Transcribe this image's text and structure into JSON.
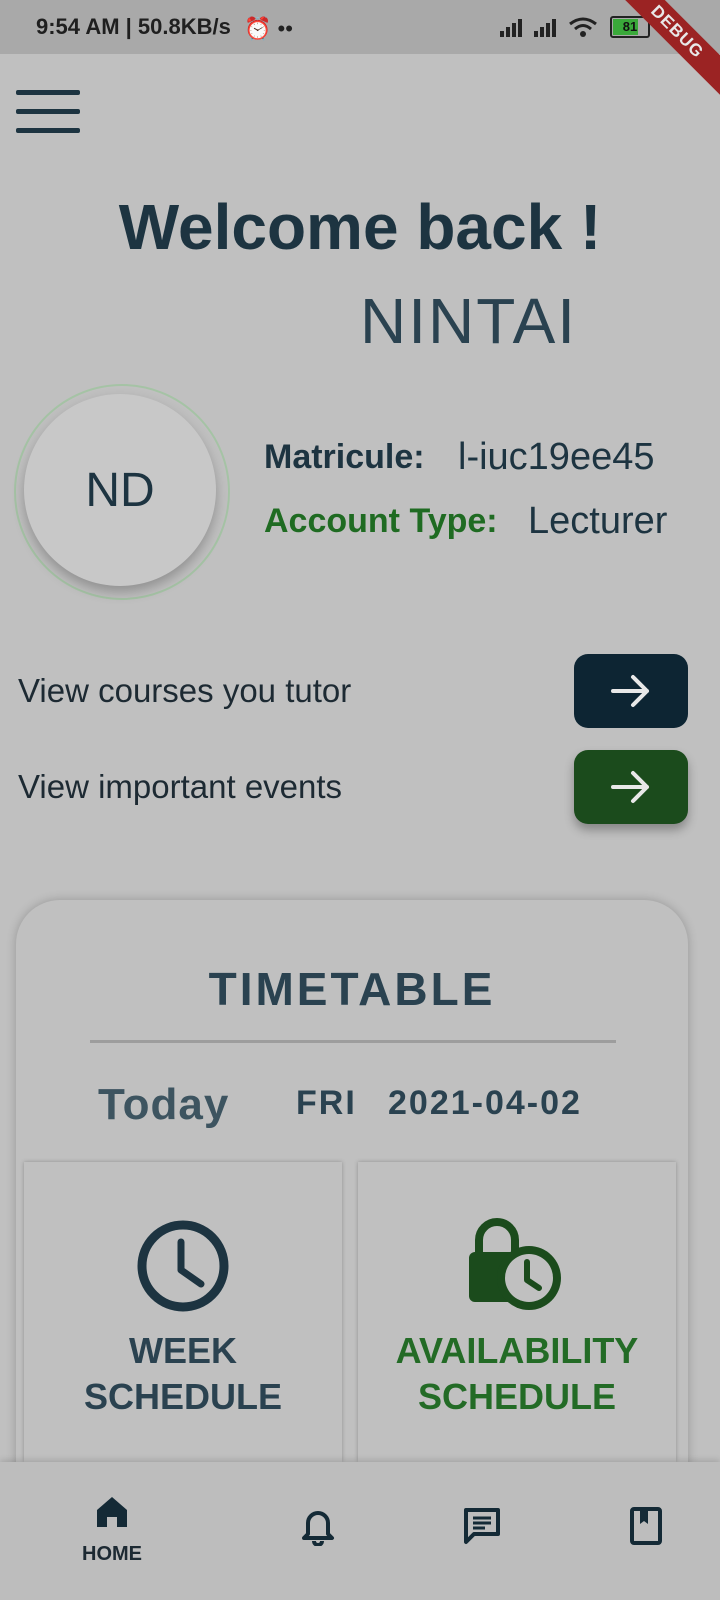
{
  "status_bar": {
    "time_speed": "9:54 AM | 50.8KB/s",
    "battery": "81",
    "debug_banner": "DEBUG"
  },
  "header": {
    "greeting": "Welcome back !",
    "username": "NINTAI"
  },
  "profile": {
    "initials": "ND",
    "matricule_label": "Matricule:",
    "matricule_value": "l-iuc19ee45",
    "account_type_label": "Account Type:",
    "account_type_value": "Lecturer"
  },
  "links": [
    {
      "label": "View courses you tutor",
      "color": "#0d2533"
    },
    {
      "label": "View important events",
      "color": "#1b4b1c"
    }
  ],
  "timetable": {
    "title": "TIMETABLE",
    "today_label": "Today",
    "day": "FRI",
    "date": "2021-04-02",
    "tiles": [
      {
        "label_line1": "WEEK",
        "label_line2": "SCHEDULE",
        "icon": "clock-icon"
      },
      {
        "label_line1": "AVAILABILITY",
        "label_line2": "SCHEDULE",
        "icon": "lock-clock-icon"
      }
    ]
  },
  "bottom_nav": {
    "home_label": "HOME",
    "items": [
      "home-icon",
      "bell-icon",
      "chat-icon",
      "bookmark-book-icon"
    ]
  },
  "colors": {
    "primary_dark": "#1d3441",
    "accent_green": "#1f6b22",
    "background": "#c0c0c0"
  }
}
